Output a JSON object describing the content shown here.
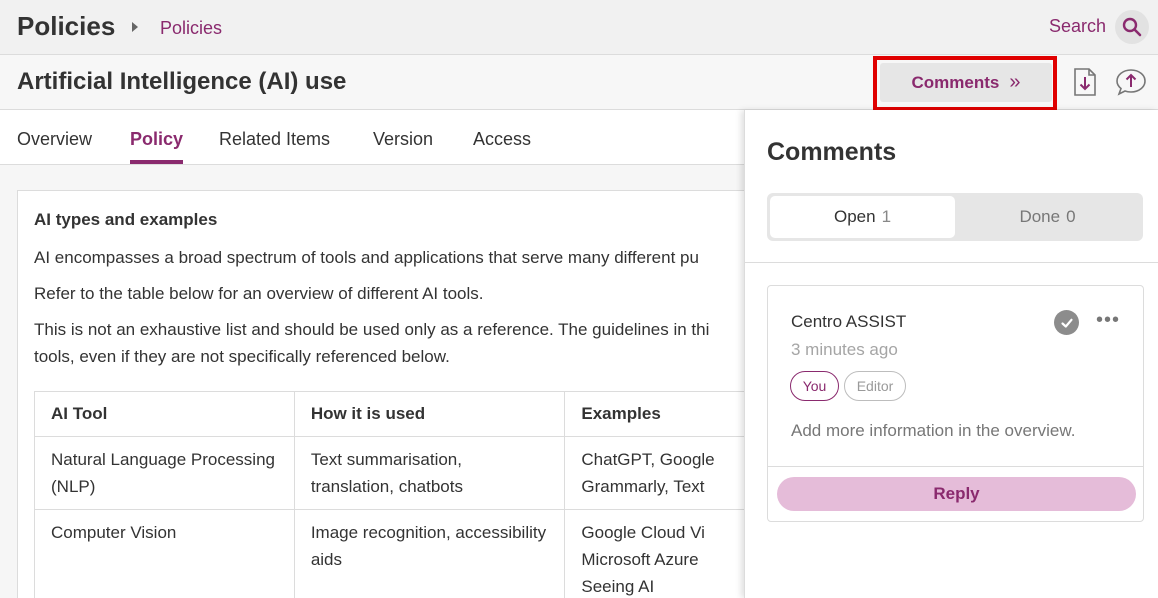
{
  "header": {
    "app_title": "Policies",
    "breadcrumb": "Policies",
    "search_label": "Search"
  },
  "document": {
    "title": "Artificial Intelligence (AI) use",
    "comments_button": "Comments",
    "comments_chevron": "»"
  },
  "tabs": [
    {
      "label": "Overview",
      "active": false
    },
    {
      "label": "Policy",
      "active": true
    },
    {
      "label": "Related Items",
      "active": false
    },
    {
      "label": "Version",
      "active": false
    },
    {
      "label": "Access",
      "active": false
    }
  ],
  "content": {
    "section_title": "AI types and examples",
    "para1": "AI encompasses a broad spectrum of tools and applications that serve many different pu",
    "para2": "Refer to the table below for an overview of different AI tools.",
    "para3_line1": "This is not an exhaustive list and should be used only as a reference. The guidelines in thi",
    "para3_line2": "tools, even if they are not specifically referenced below.",
    "table": {
      "headers": [
        "AI Tool",
        "How it is used",
        "Examples"
      ],
      "rows": [
        [
          "Natural Language Processing (NLP)",
          "Text summarisation, translation, chatbots",
          "ChatGPT, Google Grammarly, Text"
        ],
        [
          "Computer Vision",
          "Image recognition, accessibility aids",
          "Google Cloud Vi Microsoft Azure Seeing AI"
        ]
      ]
    }
  },
  "comments_panel": {
    "title": "Comments",
    "open_label": "Open",
    "open_count": "1",
    "done_label": "Done",
    "done_count": "0",
    "comment": {
      "author": "Centro ASSIST",
      "time": "3 minutes ago",
      "tag_you": "You",
      "tag_editor": "Editor",
      "text": "Add more information in the overview.",
      "more": "•••",
      "reply_label": "Reply"
    }
  },
  "colors": {
    "accent": "#8a2a6e",
    "highlight_box": "#e00000",
    "reply_bg": "#e5bcd9"
  }
}
